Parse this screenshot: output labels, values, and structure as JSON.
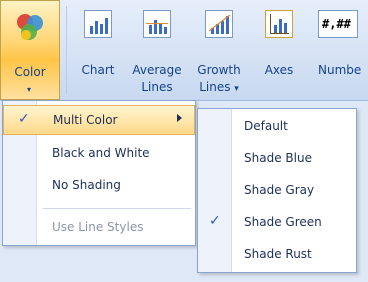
{
  "ribbon": {
    "color_label": "Color",
    "chart_label": "Chart",
    "average_lines_label_1": "Average",
    "average_lines_label_2": "Lines",
    "growth_lines_label_1": "Growth",
    "growth_lines_label_2": "Lines",
    "axes_label": "Axes",
    "numbers_label": "Numbe",
    "numbers_icon_text": "#,##",
    "dropdown_caret": "▾"
  },
  "color_menu": {
    "items": [
      {
        "label": "Multi Color",
        "checked": true,
        "has_submenu": true,
        "enabled": true
      },
      {
        "label": "Black and White",
        "checked": false,
        "enabled": true
      },
      {
        "label": "No Shading",
        "checked": false,
        "enabled": true
      },
      {
        "label": "Use Line Styles",
        "checked": false,
        "enabled": false
      }
    ]
  },
  "multi_color_submenu": {
    "items": [
      {
        "label": "Default",
        "checked": false
      },
      {
        "label": "Shade Blue",
        "checked": false
      },
      {
        "label": "Shade Gray",
        "checked": false
      },
      {
        "label": "Shade Green",
        "checked": true
      },
      {
        "label": "Shade Rust",
        "checked": false
      }
    ]
  },
  "check_glyph": "✓",
  "colors": {
    "ribbon_text": "#15428b",
    "highlight": "#ffd98a",
    "check": "#2a5bc8"
  }
}
